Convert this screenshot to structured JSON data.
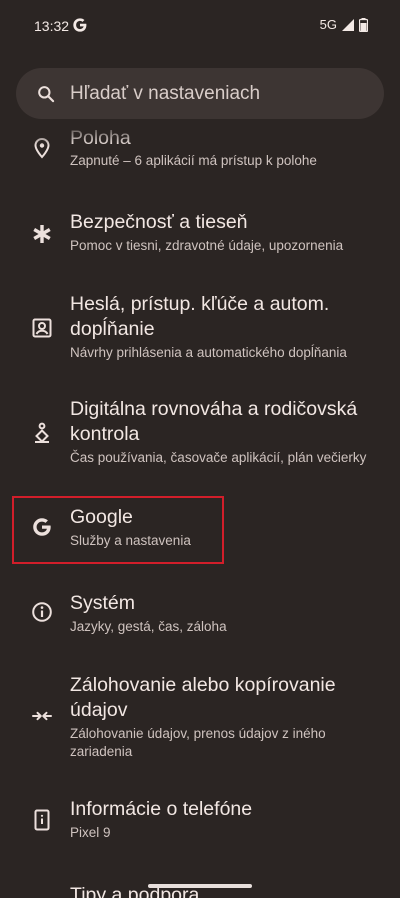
{
  "status": {
    "time": "13:32",
    "network": "5G"
  },
  "search": {
    "placeholder": "Hľadať v nastaveniach"
  },
  "items": [
    {
      "title": "Poloha",
      "subtitle": "Zapnuté – 6 aplikácií má prístup k polohe",
      "icon": "location-pin-icon"
    },
    {
      "title": "Bezpečnosť a tieseň",
      "subtitle": "Pomoc v tiesni, zdravotné údaje, upozornenia",
      "icon": "asterisk-icon"
    },
    {
      "title_line1": "Heslá, prístup. kľúče a autom.",
      "title_line2": "dopĺňanie",
      "subtitle": "Návrhy prihlásenia a automatického dopĺňania",
      "icon": "account-box-icon"
    },
    {
      "title_line1": "Digitálna rovnováha a rodičovská",
      "title_line2": "kontrola",
      "subtitle": "Čas používania, časovače aplikácií, plán večierky",
      "icon": "wellbeing-icon"
    },
    {
      "title": "Google",
      "subtitle": "Služby a nastavenia",
      "icon": "google-icon"
    },
    {
      "title": "Systém",
      "subtitle": "Jazyky, gestá, čas, záloha",
      "icon": "info-icon"
    },
    {
      "title_line1": "Zálohovanie alebo kopírovanie",
      "title_line2": "údajov",
      "subtitle_line1": "Zálohovanie údajov, prenos údajov z iného",
      "subtitle_line2": "zariadenia",
      "icon": "transfer-arrows-icon"
    },
    {
      "title": "Informácie o telefóne",
      "subtitle": "Pixel 9",
      "icon": "phone-info-icon"
    },
    {
      "title": "Tipy a podpora",
      "icon": "help-icon"
    }
  ]
}
